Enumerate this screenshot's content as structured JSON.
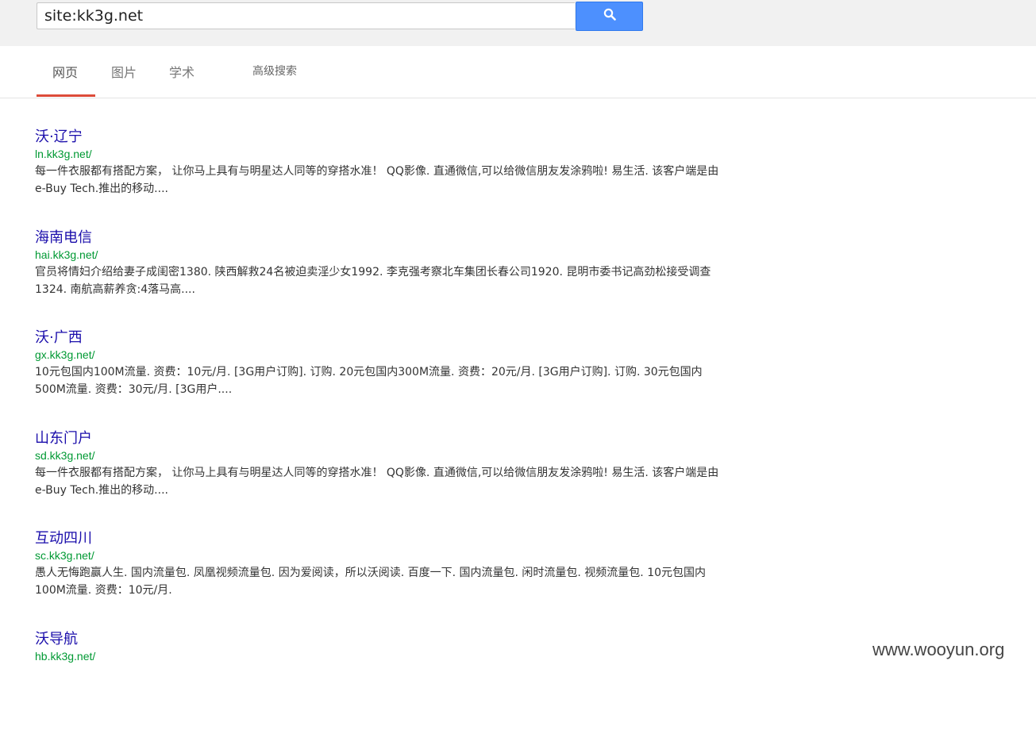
{
  "search": {
    "query": "site:kk3g.net",
    "button_icon": "search-icon",
    "button_color": "#4d90fe"
  },
  "tabs": [
    {
      "label": "网页",
      "active": true
    },
    {
      "label": "图片",
      "active": false
    },
    {
      "label": "学术",
      "active": false
    }
  ],
  "advanced_search_label": "高级搜索",
  "active_tab_underline_color": "#dd4b39",
  "colors": {
    "title": "#1a0dab",
    "url": "#009933",
    "snippet": "#333333"
  },
  "results": [
    {
      "title": "沃·辽宁",
      "url": "ln.kk3g.net/",
      "snippet": "每一件衣服都有搭配方案， 让你马上具有与明星达人同等的穿搭水准！ QQ影像. 直通微信,可以给微信朋友发涂鸦啦! 易生活. 该客户端是由e-Buy Tech.推出的移动...."
    },
    {
      "title": "海南电信",
      "url": "hai.kk3g.net/",
      "snippet": "官员将情妇介绍给妻子成闺密1380. 陕西解救24名被迫卖淫少女1992. 李克强考察北车集团长春公司1920. 昆明市委书记高劲松接受调查1324. 南航高薪养贪:4落马高...."
    },
    {
      "title": "沃·广西",
      "url": "gx.kk3g.net/",
      "snippet": "10元包国内100M流量. 资费：10元/月. [3G用户订购]. 订购. 20元包国内300M流量. 资费：20元/月. [3G用户订购]. 订购. 30元包国内500M流量. 资费：30元/月. [3G用户...."
    },
    {
      "title": "山东门户",
      "url": "sd.kk3g.net/",
      "snippet": "每一件衣服都有搭配方案， 让你马上具有与明星达人同等的穿搭水准！ QQ影像. 直通微信,可以给微信朋友发涂鸦啦! 易生活. 该客户端是由e-Buy Tech.推出的移动...."
    },
    {
      "title": "互动四川",
      "url": "sc.kk3g.net/",
      "snippet": "愚人无悔跑赢人生. 国内流量包. 凤凰视频流量包. 因为爱阅读，所以沃阅读. 百度一下. 国内流量包. 闲时流量包. 视频流量包. 10元包国内100M流量. 资费：10元/月."
    },
    {
      "title": "沃导航",
      "url": "hb.kk3g.net/",
      "snippet": ""
    }
  ],
  "watermark": "www.wooyun.org"
}
